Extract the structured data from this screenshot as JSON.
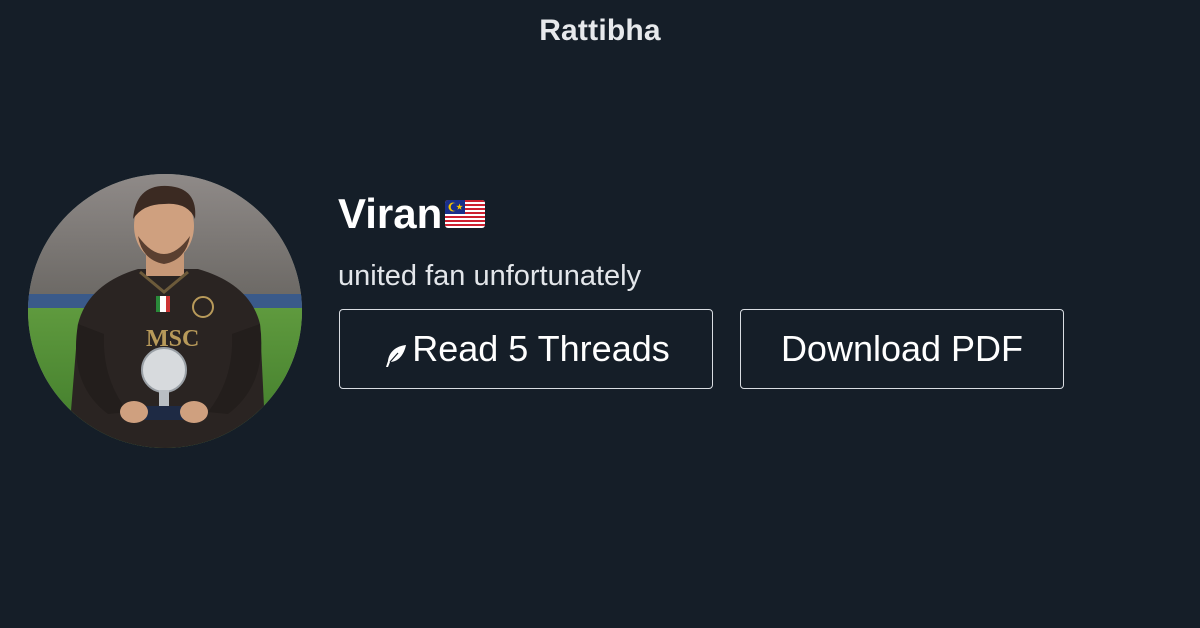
{
  "brand": "Rattibha",
  "profile": {
    "name": "Viran",
    "flag_icon": "malaysia-flag-icon",
    "bio": "united fan unfortunately"
  },
  "actions": {
    "read_label": "Read 5 Threads",
    "read_icon": "feather-icon",
    "pdf_label": "Download PDF"
  },
  "colors": {
    "background": "#151e28",
    "text": "#ffffff",
    "button_border": "#d9dde2"
  }
}
